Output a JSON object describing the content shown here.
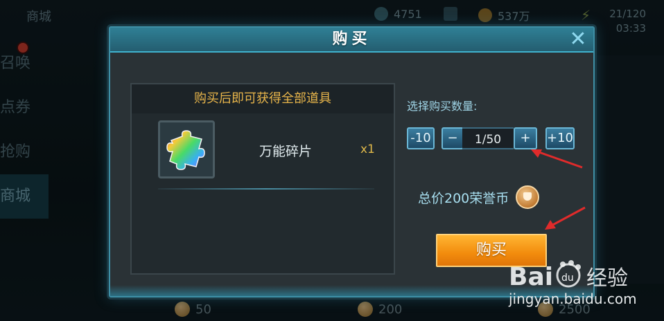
{
  "hud": {
    "title": "商城",
    "currency1": "4751",
    "currency2": "537万",
    "stamina": "21/120",
    "time": "03:33"
  },
  "side_menu": [
    "召唤",
    "点券",
    "抢购",
    "商城"
  ],
  "bottom_prices": [
    "50",
    "200",
    "2500"
  ],
  "dialog": {
    "title": "购买",
    "items_header": "购买后即可获得全部道具",
    "item": {
      "name": "万能碎片",
      "quantity": "x1",
      "icon": "rainbow-puzzle-icon"
    },
    "quantity_label": "选择购买数量:",
    "stepper": {
      "minus10": "-10",
      "minus": "−",
      "value": "1/50",
      "plus": "+",
      "plus10": "+10"
    },
    "total": "总价200荣誉币",
    "total_icon": "honor-coin-icon",
    "buy_label": "购买"
  },
  "watermark": {
    "logo": "Bai du 经验",
    "url": "jingyan.baidu.com"
  },
  "colors": {
    "accent": "#3e8fa6",
    "gold_text": "#e9b64b",
    "buy_button": "#f28c0d",
    "annotation": "#e02b2b"
  }
}
